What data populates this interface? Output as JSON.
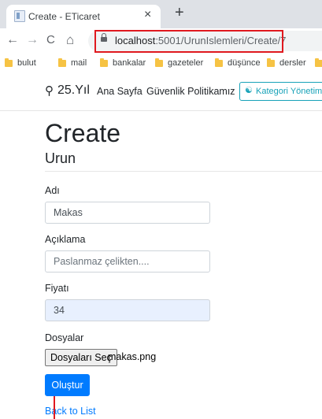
{
  "browser": {
    "tab_title": "Create - ETicaret",
    "tab_close": "×",
    "new_tab": "+",
    "nav": {
      "back": "←",
      "forward": "→",
      "reload": "C",
      "home": "⌂"
    },
    "url_host": "localhost",
    "url_path": ":5001/UrunIslemleri/Create/7",
    "highlight_color": "#e0191f",
    "bookmarks": [
      "bulut",
      "mail",
      "bankalar",
      "gazeteler",
      "düşünce",
      "dersler"
    ]
  },
  "site": {
    "brand": "25.Yıl",
    "nav_links": [
      "Ana Sayfa",
      "Güvenlik Politikamız"
    ],
    "category_button": "Kategori Yönetimi",
    "accent_color": "#17a2b8"
  },
  "form": {
    "heading": "Create",
    "subheading": "Urun",
    "name_label": "Adı",
    "name_value": "Makas",
    "desc_label": "Açıklama",
    "desc_placeholder": "Paslanmaz çelikten....",
    "price_label": "Fiyatı",
    "price_value": "34",
    "files_label": "Dosyalar",
    "file_button": "Dosyaları Seç",
    "file_name": "makas.png",
    "submit_label": "Oluştur",
    "submit_color": "#007bff",
    "back_link": "Back to List"
  }
}
